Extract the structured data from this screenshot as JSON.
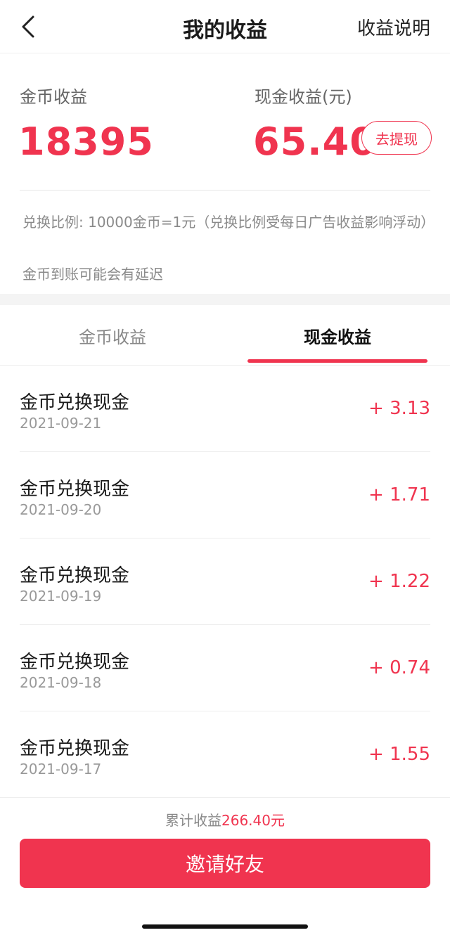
{
  "header": {
    "back_icon": "chevron-left-icon",
    "title": "我的收益",
    "help_label": "收益说明"
  },
  "summary": {
    "coin_label": "金币收益",
    "coin_value": "18395",
    "cash_label": "现金收益(元)",
    "cash_value": "65.40",
    "withdraw_label": "去提现",
    "rate_note": "兑换比例: 10000金币=1元（兑换比例受每日广告收益影响浮动）",
    "delay_note": "金币到账可能会有延迟"
  },
  "tabs": [
    {
      "label": "金币收益",
      "active": false
    },
    {
      "label": "现金收益",
      "active": true
    }
  ],
  "records": [
    {
      "title": "金币兑换现金",
      "date": "2021-09-21",
      "amount": "+ 3.13"
    },
    {
      "title": "金币兑换现金",
      "date": "2021-09-20",
      "amount": "+ 1.71"
    },
    {
      "title": "金币兑换现金",
      "date": "2021-09-19",
      "amount": "+ 1.22"
    },
    {
      "title": "金币兑换现金",
      "date": "2021-09-18",
      "amount": "+ 0.74"
    },
    {
      "title": "金币兑换现金",
      "date": "2021-09-17",
      "amount": "+ 1.55"
    }
  ],
  "footer": {
    "total_prefix": "累计收益",
    "total_value": "266.40元",
    "invite_label": "邀请好友"
  },
  "colors": {
    "accent": "#f0344f",
    "muted_text": "#888888",
    "divider": "#eeeeee"
  }
}
